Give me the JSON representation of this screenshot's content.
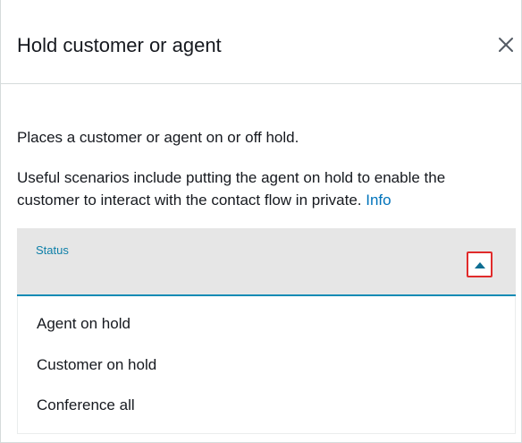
{
  "dialog": {
    "title": "Hold customer or agent",
    "close_icon": "close-icon"
  },
  "content": {
    "description": "Places a customer or agent on or off hold.",
    "scenarios_text": "Useful scenarios include putting the agent on hold to enable the customer to interact with the contact flow in private. ",
    "info_link": "Info"
  },
  "status_dropdown": {
    "label": "Status",
    "icon": "caret-up-icon",
    "expanded": true,
    "options": [
      "Agent on hold",
      "Customer on hold",
      "Conference all"
    ]
  },
  "colors": {
    "link": "#0073bb",
    "accent": "#0f8bb5",
    "highlight_box": "#e02b2b",
    "dropdown_bg": "#e6e6e6"
  }
}
